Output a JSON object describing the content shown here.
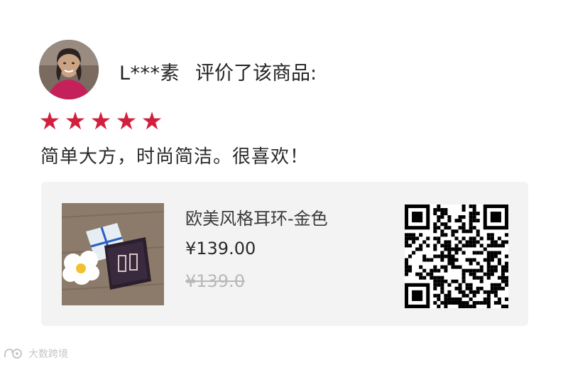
{
  "review": {
    "user_name": "L***素",
    "action_text": "评价了该商品:",
    "rating": 5,
    "rating_max": 5,
    "text": "简单大方，时尚简洁。很喜欢！"
  },
  "product": {
    "name": "欧美风格耳环-金色",
    "price": "¥139.00",
    "original_price": "¥139.0"
  },
  "watermark": {
    "text": "大数跨境"
  },
  "colors": {
    "star": "#d21f3c",
    "card_bg": "#f4f3f4"
  }
}
